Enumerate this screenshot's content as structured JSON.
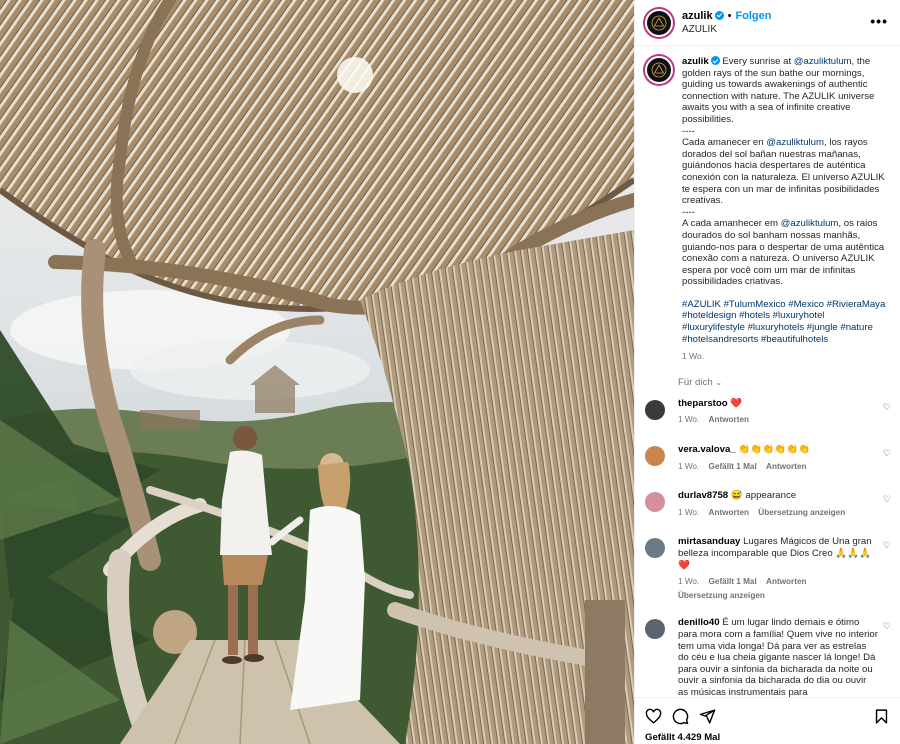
{
  "header": {
    "username": "azulik",
    "follow_label": "Folgen",
    "subtitle": "AZULIK"
  },
  "caption": {
    "username": "azulik",
    "p1_pre": "Every sunrise at ",
    "p1_mention": "@azuliktulum",
    "p1_post": ", the golden rays of the sun bathe our mornings, guiding us towards awakenings of authentic connection with nature. The AZULIK universe awaits you with a sea of infinite creative possibilities.",
    "sep1": "----",
    "p2_pre": "Cada amanecer en ",
    "p2_mention": "@azuliktulum",
    "p2_post": ", los rayos dorados del sol bañan nuestras mañanas, guiándonos hacia despertares de auténtica conexión con la naturaleza. El universo AZULIK te espera con un mar de infinitas posibilidades creativas.",
    "sep2": "----",
    "p3_pre": "A cada amanhecer em ",
    "p3_mention": "@azuliktulum",
    "p3_post": ", os raios dourados do sol banham nossas manhãs, guiando-nos para o despertar de uma autêntica conexão com a natureza. O universo AZULIK espera por você com um mar de infinitas possibilidades criativas.",
    "hashtags": "#AZULIK #TulumMexico #Mexico #RivieraMaya #hoteldesign #hotels #luxuryhotel #luxurylifestyle #luxuryhotels #jungle #nature #hotelsandresorts #beautifulhotels",
    "time": "1 Wo."
  },
  "sort_label": "Für dich",
  "comments": [
    {
      "user": "theparstoo",
      "text": "❤️",
      "time": "1 Wo.",
      "likes": "",
      "reply": "Antworten",
      "translate": "",
      "avatar_color": "#3a3a3a"
    },
    {
      "user": "vera.valova_",
      "text": "👏👏👏👏👏👏",
      "time": "1 Wo.",
      "likes": "Gefällt 1 Mal",
      "reply": "Antworten",
      "translate": "",
      "avatar_color": "#c9874f"
    },
    {
      "user": "durlav8758",
      "text": "😅 appearance",
      "time": "1 Wo.",
      "likes": "",
      "reply": "Antworten",
      "translate": "Übersetzung anzeigen",
      "avatar_color": "#d58fa0"
    },
    {
      "user": "mirtasanduay",
      "text": "Lugares Mágicos de Una gran belleza incomparable que Dios Creo 🙏🙏🙏❤️",
      "time": "1 Wo.",
      "likes": "Gefällt 1 Mal",
      "reply": "Antworten",
      "translate": "Übersetzung anzeigen",
      "avatar_color": "#6b7a84"
    },
    {
      "user": "denillo40",
      "text": "É um lugar lindo demais e ótimo para mora com a família! Quem vive no interior tem uma vida longa! Dá para ver as estrelas do céu e lua cheia gigante nascer lá longe! Dá para ouvir a sinfonia da bicharada da noite ou ouvir a sinfonia da bicharada do dia ou ouvir as músicas instrumentais para",
      "time": "",
      "likes": "",
      "reply": "",
      "translate": "",
      "avatar_color": "#5a6470"
    }
  ],
  "footer": {
    "likes_text": "Gefällt 4.429 Mal"
  },
  "icons": [
    "heart-icon",
    "comment-icon",
    "share-icon",
    "bookmark-icon",
    "more-options-icon",
    "verified-icon"
  ]
}
